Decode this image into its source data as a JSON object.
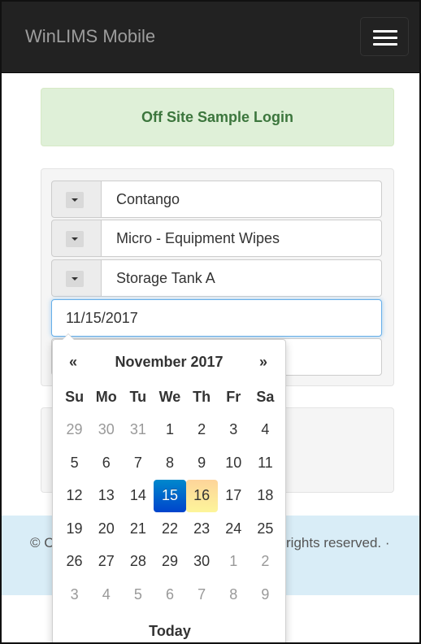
{
  "navbar": {
    "brand": "WinLIMS Mobile",
    "menu_icon": "hamburger-menu-icon"
  },
  "alert": {
    "title": "Off Site Sample Login"
  },
  "form": {
    "selects": [
      {
        "value": "Contango"
      },
      {
        "value": "Micro - Equipment Wipes"
      },
      {
        "value": "Storage Tank A"
      }
    ],
    "date_value": "11/15/2017"
  },
  "datepicker": {
    "prev": "«",
    "next": "»",
    "title": "November 2017",
    "weekdays": [
      "Su",
      "Mo",
      "Tu",
      "We",
      "Th",
      "Fr",
      "Sa"
    ],
    "weeks": [
      [
        "29",
        "30",
        "31",
        "1",
        "2",
        "3",
        "4"
      ],
      [
        "5",
        "6",
        "7",
        "8",
        "9",
        "10",
        "11"
      ],
      [
        "12",
        "13",
        "14",
        "15",
        "16",
        "17",
        "18"
      ],
      [
        "19",
        "20",
        "21",
        "22",
        "23",
        "24",
        "25"
      ],
      [
        "26",
        "27",
        "28",
        "29",
        "30",
        "1",
        "2"
      ],
      [
        "3",
        "4",
        "5",
        "6",
        "7",
        "8",
        "9"
      ]
    ],
    "selected_day": "15",
    "today_day": "16",
    "today_label": "Today",
    "colors": {
      "selected": "#0055cc",
      "today": "#fde19a",
      "muted": "#999999"
    }
  },
  "footer": {
    "left": "© C",
    "right": "rights reserved. ·"
  }
}
